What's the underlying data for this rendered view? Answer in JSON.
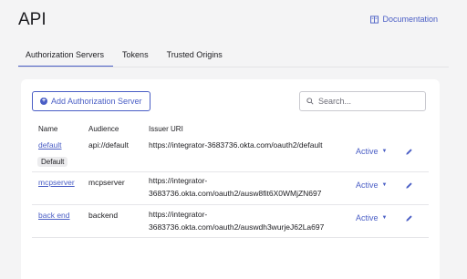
{
  "header": {
    "title": "API",
    "doc_link": "Documentation"
  },
  "tabs": [
    {
      "label": "Authorization Servers",
      "active": true
    },
    {
      "label": "Tokens",
      "active": false
    },
    {
      "label": "Trusted Origins",
      "active": false
    }
  ],
  "toolbar": {
    "add_label": "Add Authorization Server",
    "search_placeholder": "Search..."
  },
  "table": {
    "headers": [
      "Name",
      "Audience",
      "Issuer URI"
    ],
    "rows": [
      {
        "name": "default",
        "badge": "Default",
        "audience": "api://default",
        "issuer_line1": "https://integrator-3683736.okta.com/oauth2/default",
        "issuer_line2": "",
        "status": "Active"
      },
      {
        "name": "mcpserver",
        "badge": "",
        "audience": "mcpserver",
        "issuer_line1": "https://integrator-",
        "issuer_line2": "3683736.okta.com/oauth2/ausw8fit6X0WMjZN697",
        "status": "Active"
      },
      {
        "name": "back end",
        "badge": "",
        "audience": "backend",
        "issuer_line1": "https://integrator-",
        "issuer_line2": "3683736.okta.com/oauth2/auswdh3wurjeJ62La697",
        "status": "Active"
      }
    ]
  },
  "colors": {
    "accent": "#4a5ec5",
    "background": "#f4f4f5",
    "card": "#ffffff"
  },
  "icons": {
    "doc": "book-icon",
    "add": "plus-circle-icon",
    "search": "search-icon",
    "edit": "pencil-icon",
    "caret": "caret-down-icon"
  }
}
